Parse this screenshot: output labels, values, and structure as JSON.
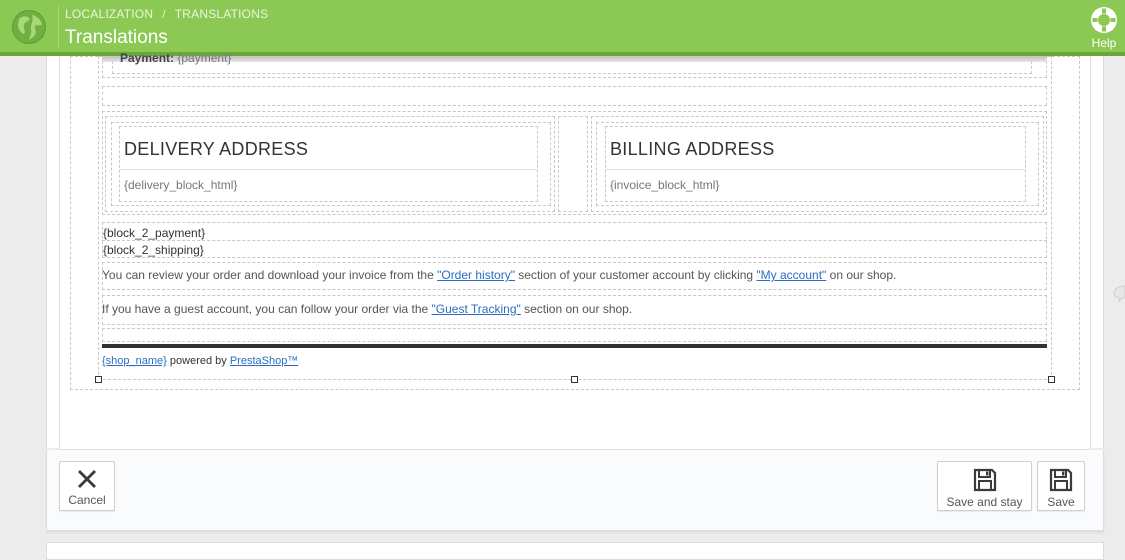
{
  "header": {
    "breadcrumb": [
      "LOCALIZATION",
      "TRANSLATIONS"
    ],
    "breadcrumb_sep": "/",
    "title": "Translations",
    "help_label": "Help",
    "colors": {
      "bar": "#8bc954",
      "bar_border": "#6aa83b"
    }
  },
  "email": {
    "payment_label": "Payment:",
    "payment_value": "{payment}",
    "delivery_title": "DELIVERY ADDRESS",
    "delivery_tag": "{delivery_block_html}",
    "billing_title": "BILLING ADDRESS",
    "billing_tag": "{invoice_block_html}",
    "block_payment": "{block_2_payment}",
    "block_shipping": "{block_2_shipping}",
    "review_text_1": "You can review your order and download your invoice from the ",
    "order_history_link": "\"Order history\"",
    "review_text_2": " section of your customer account by clicking ",
    "my_account_link": "\"My account\"",
    "review_text_3": " on our shop.",
    "guest_text_1": "If you have a guest account, you can follow your order via the ",
    "guest_tracking_link": "\"Guest Tracking\"",
    "guest_text_2": " section on our shop.",
    "shop_name_link": "{shop_name}",
    "powered_by": " powered by ",
    "prestashop_link": "PrestaShop™"
  },
  "toolbar": {
    "cancel_label": "Cancel",
    "save_stay_label": "Save and stay",
    "save_label": "Save"
  },
  "icons": {
    "globe": "globe-icon",
    "help": "lifebuoy-icon",
    "cancel": "close-icon",
    "save": "floppy-disk-icon"
  }
}
